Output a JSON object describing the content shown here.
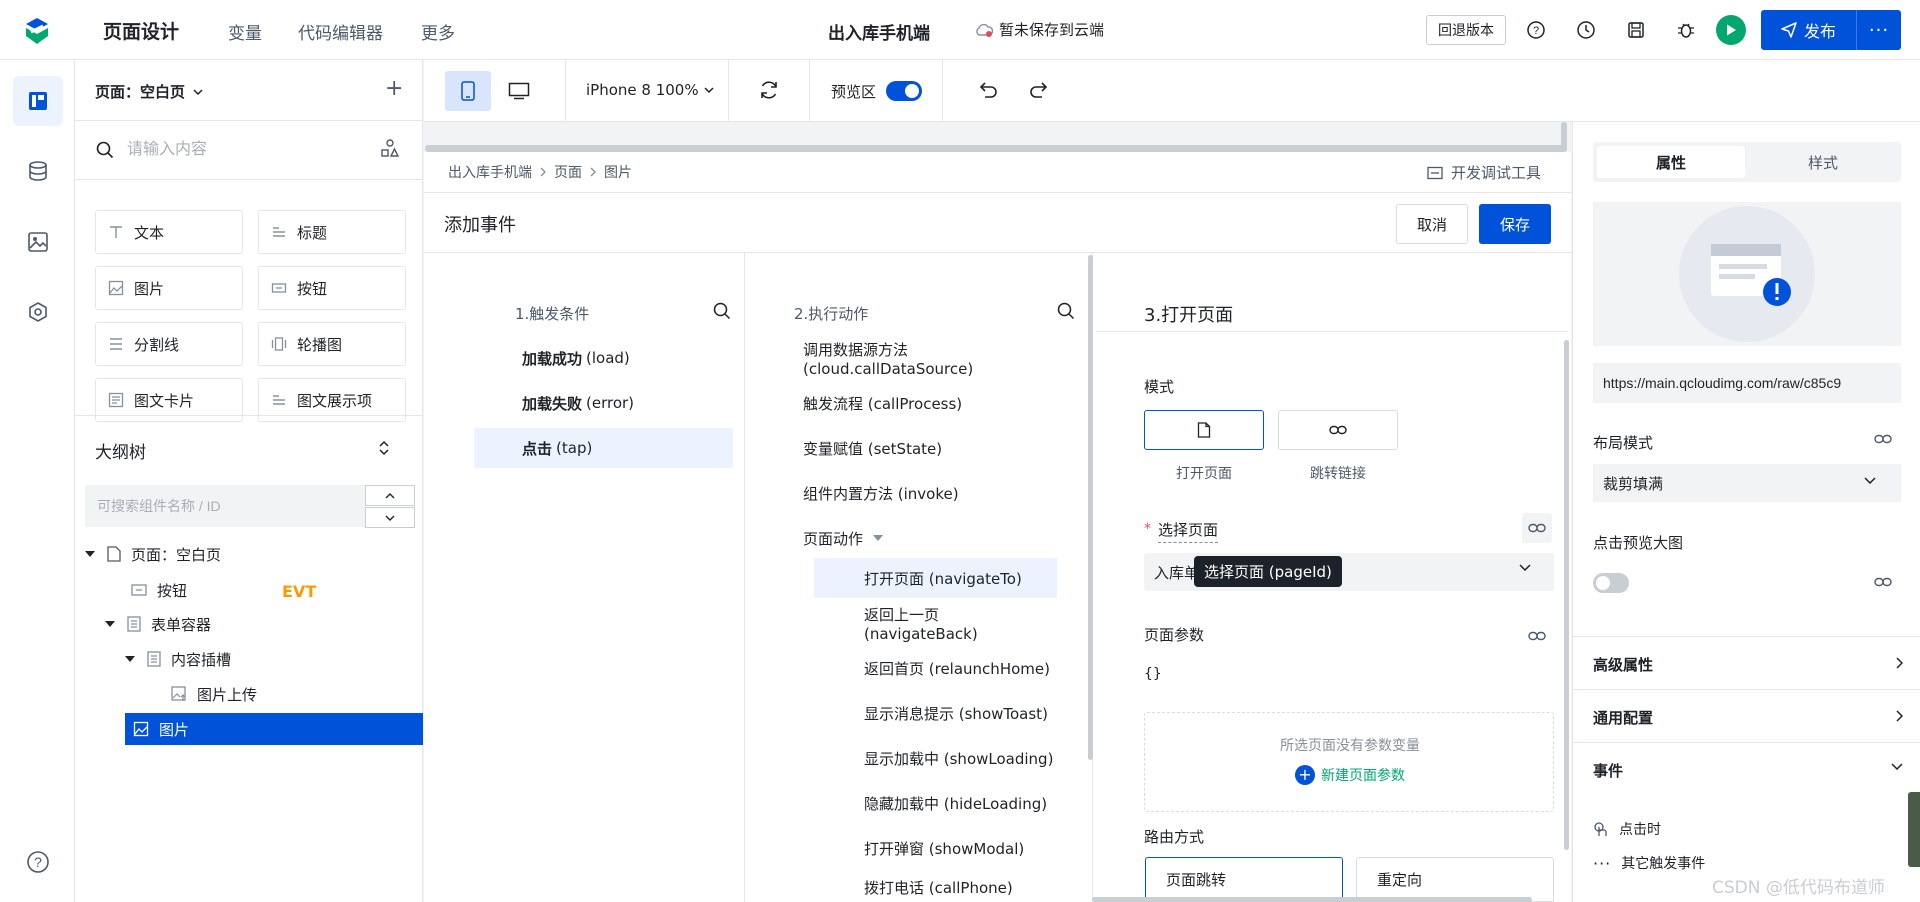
{
  "header": {
    "app_title": "页面设计",
    "nav": [
      "变量",
      "代码编辑器",
      "更多"
    ],
    "center_title": "出入库手机端",
    "save_status": "暂未保存到云端",
    "rollback": "回退版本",
    "publish": "发布",
    "publish_more": "···"
  },
  "component_panel": {
    "page_select": "页面：空白页",
    "add": "+",
    "search_placeholder": "请输入内容",
    "components": [
      "文本",
      "标题",
      "图片",
      "按钮",
      "分割线",
      "轮播图",
      "图文卡片",
      "图文展示项"
    ]
  },
  "outline": {
    "title": "大纲树",
    "search_placeholder": "可搜索组件名称 / ID",
    "tree": [
      {
        "label": "页面：空白页"
      },
      {
        "label": "按钮",
        "badge": "EVT"
      },
      {
        "label": "表单容器"
      },
      {
        "label": "内容插槽"
      },
      {
        "label": "图片上传"
      },
      {
        "label": "图片"
      }
    ]
  },
  "toolbar": {
    "device": "iPhone 8 100%",
    "preview_label": "预览区",
    "preview_on": true
  },
  "dialog": {
    "breadcrumb": [
      "出入库手机端",
      "页面",
      "图片"
    ],
    "devtools": "开发调试工具",
    "title": "添加事件",
    "cancel": "取消",
    "save": "保存",
    "triggers": {
      "heading": "1.触发条件",
      "items": [
        {
          "bold": "加载成功",
          "code": "(load)"
        },
        {
          "bold": "加载失败",
          "code": "(error)"
        },
        {
          "bold": "点击",
          "code": "(tap)"
        }
      ]
    },
    "actions": {
      "heading": "2.执行动作",
      "items": [
        "调用数据源方法 (cloud.callDataSource)",
        "触发流程 (callProcess)",
        "变量赋值 (setState)",
        "组件内置方法 (invoke)",
        "页面动作"
      ],
      "sub_items": [
        "打开页面 (navigateTo)",
        "返回上一页 (navigateBack)",
        "返回首页 (relaunchHome)",
        "显示消息提示 (showToast)",
        "显示加载中 (showLoading)",
        "隐藏加载中 (hideLoading)",
        "打开弹窗 (showModal)",
        "拨打电话 (callPhone)"
      ]
    },
    "config": {
      "heading": "3.打开页面",
      "mode_label": "模式",
      "modes": [
        "打开页面",
        "跳转链接"
      ],
      "select_page_label": "选择页面",
      "select_page_value": "入库单",
      "tooltip": "选择页面 (pageId)",
      "params_label": "页面参数",
      "params_value": "{}",
      "params_empty": "所选页面没有参数变量",
      "new_param": "新建页面参数",
      "route_label": "路由方式",
      "routes": [
        "页面跳转",
        "重定向"
      ]
    }
  },
  "props": {
    "tabs": [
      "属性",
      "样式"
    ],
    "url": "https://main.qcloudimg.com/raw/c85c9",
    "layout_label": "布局模式",
    "layout_value": "裁剪填满",
    "zoom_label": "点击预览大图",
    "zoom_on": false,
    "sections": [
      "高级属性",
      "通用配置",
      "事件"
    ],
    "event_items": [
      "点击时",
      "其它触发事件"
    ]
  },
  "watermark": "CSDN @低代码布道师",
  "colors": {
    "primary": "#0052d9",
    "success": "#00a870",
    "warning": "#ff9900",
    "danger": "#e34d59"
  }
}
